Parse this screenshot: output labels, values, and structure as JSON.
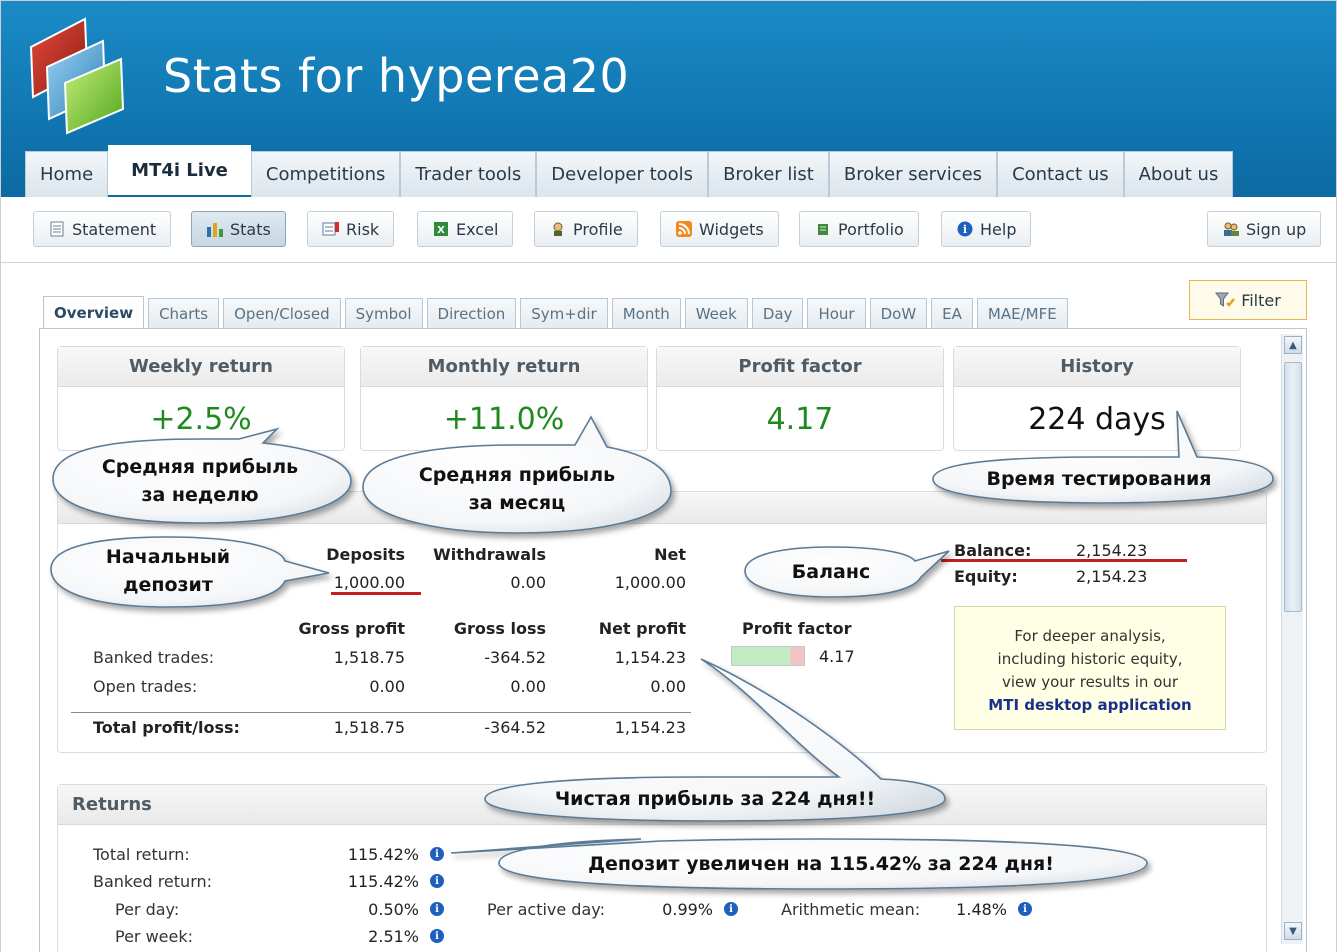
{
  "header": {
    "title": "Stats for hyperea20"
  },
  "main_nav": [
    {
      "label": "Home",
      "active": false
    },
    {
      "label": "MT4i Live",
      "active": true
    },
    {
      "label": "Competitions",
      "active": false
    },
    {
      "label": "Trader tools",
      "active": false
    },
    {
      "label": "Developer tools",
      "active": false
    },
    {
      "label": "Broker list",
      "active": false
    },
    {
      "label": "Broker services",
      "active": false
    },
    {
      "label": "Contact us",
      "active": false
    },
    {
      "label": "About us",
      "active": false
    }
  ],
  "toolbar": {
    "statement": "Statement",
    "stats": "Stats",
    "risk": "Risk",
    "excel": "Excel",
    "profile": "Profile",
    "widgets": "Widgets",
    "portfolio": "Portfolio",
    "help": "Help",
    "signup": "Sign up"
  },
  "sub_tabs": [
    "Overview",
    "Charts",
    "Open/Closed",
    "Symbol",
    "Direction",
    "Sym+dir",
    "Month",
    "Week",
    "Day",
    "Hour",
    "DoW",
    "EA",
    "MAE/MFE"
  ],
  "filter_label": "Filter",
  "stat_boxes": {
    "weekly": {
      "label": "Weekly return",
      "value": "+2.5%"
    },
    "monthly": {
      "label": "Monthly return",
      "value": "+11.0%"
    },
    "profit_factor": {
      "label": "Profit factor",
      "value": "4.17"
    },
    "history": {
      "label": "History",
      "value": "224 days"
    }
  },
  "summary": {
    "deposits_hd": "Deposits",
    "withdrawals_hd": "Withdrawals",
    "net_hd": "Net",
    "deposits": "1,000.00",
    "withdrawals": "0.00",
    "net": "1,000.00",
    "balance_label": "Balance:",
    "balance": "2,154.23",
    "equity_label": "Equity:",
    "equity": "2,154.23",
    "gross_profit_hd": "Gross profit",
    "gross_loss_hd": "Gross loss",
    "net_profit_hd": "Net profit",
    "profit_factor_hd": "Profit factor",
    "banked_label": "Banked trades:",
    "banked_gp": "1,518.75",
    "banked_gl": "-364.52",
    "banked_np": "1,154.23",
    "profit_factor": "4.17",
    "profit_factor_ratio": 0.81,
    "open_label": "Open trades:",
    "open_gp": "0.00",
    "open_gl": "0.00",
    "open_np": "0.00",
    "total_label": "Total profit/loss:",
    "total_gp": "1,518.75",
    "total_gl": "-364.52",
    "total_np": "1,154.23",
    "mti_line1": "For deeper analysis,",
    "mti_line2": "including historic equity,",
    "mti_line3": "view your results in our",
    "mti_link": "MTI desktop application"
  },
  "returns": {
    "title": "Returns",
    "total_label": "Total return:",
    "total": "115.42%",
    "banked_label": "Banked return:",
    "banked": "115.42%",
    "per_day_label": "Per day:",
    "per_day": "0.50%",
    "per_week_label": "Per week:",
    "per_week": "2.51%",
    "per_active_day_label": "Per active day:",
    "per_active_day": "0.99%",
    "arith_label": "Arithmetic mean:",
    "arith": "1.48%"
  },
  "callouts": {
    "weekly_line1": "Средняя прибыль",
    "weekly_line2": "за неделю",
    "monthly_line1": "Средняя прибыль",
    "monthly_line2": "за месяц",
    "history": "Время тестирования",
    "initial_line1": "Начальный",
    "initial_line2": "депозит",
    "balance": "Баланс",
    "net_profit": "Чистая прибыль за 224 дня!!",
    "deposit_growth": "Депозит увеличен на 115.42% за 224 дня!"
  },
  "colors": {
    "header": "#0f73ad",
    "positive": "#1e8a1e",
    "underline": "#c42020",
    "link": "#1a2f8a"
  }
}
